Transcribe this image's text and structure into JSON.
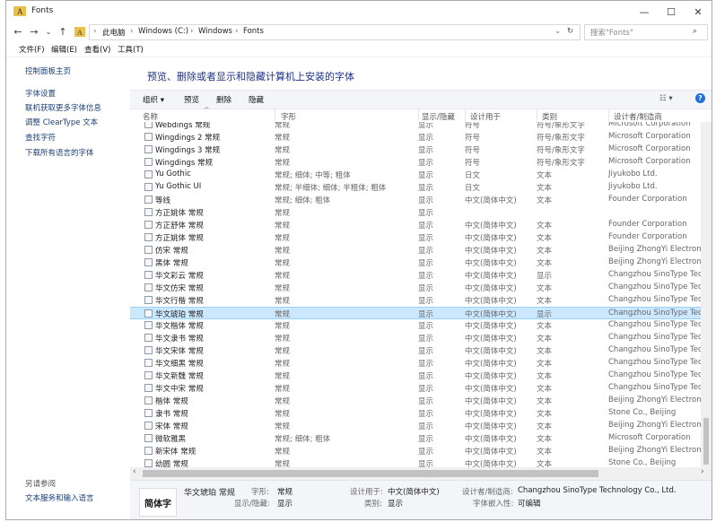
{
  "window": {
    "title": "Fonts",
    "minimize": "—",
    "maximize": "☐",
    "close": "✕"
  },
  "nav": {
    "back": "←",
    "forward": "→",
    "recent": "⌄",
    "up": "↑",
    "breadcrumb": [
      "此电脑",
      "Windows (C:)",
      "Windows",
      "Fonts"
    ],
    "refresh": "↻",
    "search_placeholder": "搜索\"Fonts\""
  },
  "menu": [
    "文件(F)",
    "编辑(E)",
    "查看(V)",
    "工具(T)"
  ],
  "sidebar": {
    "home": "控制面板主页",
    "links": [
      "字体设置",
      "联机获取更多字体信息",
      "调整 ClearType 文本",
      "查找字符",
      "下载所有语言的字体"
    ],
    "see_also": "另请参阅",
    "see_also_links": [
      "文本服务和输入语言"
    ]
  },
  "heading": "预览、删除或者显示和隐藏计算机上安装的字体",
  "toolbar": {
    "organize": "组织 ▾",
    "preview": "预览",
    "delete": "删除",
    "hide": "隐藏",
    "view": "☷ ▾",
    "help": "?"
  },
  "columns": [
    "名称",
    "字形",
    "显示/隐藏",
    "设计用于",
    "类别",
    "设计者/制造商"
  ],
  "rows": [
    {
      "name": "Webdings 常规",
      "style": "常规",
      "show": "显示",
      "design": "符号",
      "cat": "符号/象形文字",
      "maker": "Microsoft Corporation"
    },
    {
      "name": "Wingdings 2 常规",
      "style": "常规",
      "show": "显示",
      "design": "符号",
      "cat": "符号/象形文字",
      "maker": "Microsoft Corporation"
    },
    {
      "name": "Wingdings 3 常规",
      "style": "常规",
      "show": "显示",
      "design": "符号",
      "cat": "符号/象形文字",
      "maker": "Microsoft Corporation"
    },
    {
      "name": "Wingdings 常规",
      "style": "常规",
      "show": "显示",
      "design": "符号",
      "cat": "符号/象形文字",
      "maker": "Microsoft Corporation"
    },
    {
      "name": "Yu Gothic",
      "style": "常规; 细体; 中等; 粗体",
      "show": "显示",
      "design": "日文",
      "cat": "文本",
      "maker": "Jiyukobo Ltd."
    },
    {
      "name": "Yu Gothic UI",
      "style": "常规; 半细体; 细体; 半粗体; 粗体",
      "show": "显示",
      "design": "日文",
      "cat": "文本",
      "maker": "Jiyukobo Ltd."
    },
    {
      "name": "等线",
      "style": "常规; 细体; 粗体",
      "show": "显示",
      "design": "中文(简体中文)",
      "cat": "文本",
      "maker": "Founder Corporation"
    },
    {
      "name": "方正姚体 常规",
      "style": "常规",
      "show": "显示",
      "design": "",
      "cat": "",
      "maker": ""
    },
    {
      "name": "方正舒体 常规",
      "style": "常规",
      "show": "显示",
      "design": "中文(简体中文)",
      "cat": "文本",
      "maker": "Founder Corporation"
    },
    {
      "name": "方正姚体 常规",
      "style": "常规",
      "show": "显示",
      "design": "中文(简体中文)",
      "cat": "文本",
      "maker": "Founder Corporation"
    },
    {
      "name": "仿宋 常规",
      "style": "常规",
      "show": "显示",
      "design": "中文(简体中文)",
      "cat": "文本",
      "maker": "Beijing ZhongYi Electronics"
    },
    {
      "name": "黑体 常规",
      "style": "常规",
      "show": "显示",
      "design": "中文(简体中文)",
      "cat": "文本",
      "maker": "Beijing ZhongYi Electronics"
    },
    {
      "name": "华文彩云 常规",
      "style": "常规",
      "show": "显示",
      "design": "中文(简体中文)",
      "cat": "显示",
      "maker": "Changzhou SinoType Techn"
    },
    {
      "name": "华文仿宋 常规",
      "style": "常规",
      "show": "显示",
      "design": "中文(简体中文)",
      "cat": "文本",
      "maker": "Changzhou SinoType Techn"
    },
    {
      "name": "华文行楷 常规",
      "style": "常规",
      "show": "显示",
      "design": "中文(简体中文)",
      "cat": "文本",
      "maker": "Changzhou SinoType Techn"
    },
    {
      "name": "华文琥珀 常规",
      "style": "常规",
      "show": "显示",
      "design": "中文(简体中文)",
      "cat": "显示",
      "maker": "Changzhou SinoType Techn",
      "selected": true
    },
    {
      "name": "华文楷体 常规",
      "style": "常规",
      "show": "显示",
      "design": "中文(简体中文)",
      "cat": "文本",
      "maker": "Changzhou SinoType Techn"
    },
    {
      "name": "华文隶书 常规",
      "style": "常规",
      "show": "显示",
      "design": "中文(简体中文)",
      "cat": "文本",
      "maker": "Changzhou SinoType Techn"
    },
    {
      "name": "华文宋体 常规",
      "style": "常规",
      "show": "显示",
      "design": "中文(简体中文)",
      "cat": "文本",
      "maker": "Changzhou SinoType Techn"
    },
    {
      "name": "华文细黑 常规",
      "style": "常规",
      "show": "显示",
      "design": "中文(简体中文)",
      "cat": "文本",
      "maker": "Changzhou SinoType Techn"
    },
    {
      "name": "华文新魏 常规",
      "style": "常规",
      "show": "显示",
      "design": "中文(简体中文)",
      "cat": "文本",
      "maker": "Changzhou SinoType Techn"
    },
    {
      "name": "华文中宋 常规",
      "style": "常规",
      "show": "显示",
      "design": "中文(简体中文)",
      "cat": "文本",
      "maker": "Changzhou SinoType Techn"
    },
    {
      "name": "楷体 常规",
      "style": "常规",
      "show": "显示",
      "design": "中文(简体中文)",
      "cat": "文本",
      "maker": "Beijing ZhongYi Electronics"
    },
    {
      "name": "隶书 常规",
      "style": "常规",
      "show": "显示",
      "design": "中文(简体中文)",
      "cat": "文本",
      "maker": "Stone Co., Beijing"
    },
    {
      "name": "宋体 常规",
      "style": "常规",
      "show": "显示",
      "design": "中文(简体中文)",
      "cat": "文本",
      "maker": "Beijing ZhongYi Electronics"
    },
    {
      "name": "微软雅黑",
      "style": "常规; 细体; 粗体",
      "show": "显示",
      "design": "中文(简体中文)",
      "cat": "文本",
      "maker": "Microsoft Corporation"
    },
    {
      "name": "新宋体 常规",
      "style": "常规",
      "show": "显示",
      "design": "中文(简体中文)",
      "cat": "文本",
      "maker": "Beijing ZhongYi Electronics"
    },
    {
      "name": "幼圆 常规",
      "style": "常规",
      "show": "显示",
      "design": "中文(简体中文)",
      "cat": "文本",
      "maker": "Stone Co., Beijing"
    }
  ],
  "details": {
    "preview_text": "简体字",
    "name": "华文琥珀 常规",
    "style_label": "字形:",
    "style": "常规",
    "show_label": "显示/隐藏:",
    "show": "显示",
    "design_label": "设计用于:",
    "design": "中文(简体中文)",
    "cat_label": "类别:",
    "cat": "显示",
    "maker_label": "设计者/制造商:",
    "maker": "Changzhou SinoType Technology Co., Ltd.",
    "embed_label": "字体嵌入性:",
    "embed": "可编辑"
  },
  "colors": {
    "accent": "#1e3287",
    "selected_row": "#cce8ff"
  }
}
